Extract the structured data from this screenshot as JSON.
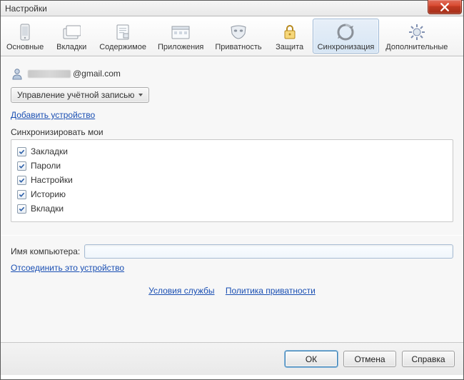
{
  "window": {
    "title": "Настройки"
  },
  "tabs": [
    {
      "label": "Основные"
    },
    {
      "label": "Вкладки"
    },
    {
      "label": "Содержимое"
    },
    {
      "label": "Приложения"
    },
    {
      "label": "Приватность"
    },
    {
      "label": "Защита"
    },
    {
      "label": "Синхронизация"
    },
    {
      "label": "Дополнительные"
    }
  ],
  "sync": {
    "email_domain": "@gmail.com",
    "manage_account_label": "Управление учётной записью",
    "add_device_link": "Добавить устройство",
    "sync_my_label": "Синхронизировать мои",
    "items": [
      {
        "label": "Закладки",
        "checked": true
      },
      {
        "label": "Пароли",
        "checked": true
      },
      {
        "label": "Настройки",
        "checked": true
      },
      {
        "label": "Историю",
        "checked": true
      },
      {
        "label": "Вкладки",
        "checked": true
      }
    ],
    "computer_name_label": "Имя компьютера:",
    "computer_name_value": "",
    "disconnect_link": "Отсоединить это устройство",
    "tos_link": "Условия службы",
    "privacy_link": "Политика приватности"
  },
  "footer": {
    "ok": "ОК",
    "cancel": "Отмена",
    "help": "Справка"
  }
}
